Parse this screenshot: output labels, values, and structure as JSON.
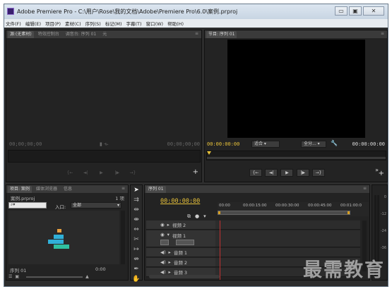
{
  "window": {
    "title": "Adobe Premiere Pro - C:\\用户\\Rose\\我的文档\\Adobe\\Premiere Pro\\6.0\\案例.prproj",
    "min_glyph": "▭",
    "max_glyph": "▣",
    "close_glyph": "✕"
  },
  "menu": [
    "文件(F)",
    "编辑(E)",
    "项目(P)",
    "素材(C)",
    "序列(S)",
    "标记(M)",
    "字幕(T)",
    "窗口(W)",
    "帮助(H)"
  ],
  "source_panel": {
    "tabs": [
      "源:(无素材)",
      "特效控制台",
      "调音台: 序列 01",
      "元"
    ],
    "timecode_left": "00;00;00;00",
    "timecode_right": "00;00;00;00"
  },
  "program_panel": {
    "tabs": [
      "节目: 序列 01"
    ],
    "timecode_left": "00:00:00:00",
    "fit_label": "适合",
    "quality_label": "全分...",
    "timecode_right": "00:00:00:00"
  },
  "project_panel": {
    "tabs": [
      "项目: 案例",
      "媒体浏览器",
      "信息"
    ],
    "project_file": "案例.prproj",
    "item_count": "1 项",
    "search_placeholder": "",
    "entry_label": "入口:",
    "entry_value": "全部",
    "item_name": "序列 01",
    "item_duration": "0:00"
  },
  "timeline_panel": {
    "tabs": [
      "序列 01"
    ],
    "timecode": "00:00:00:00",
    "ruler_labels": [
      "00:00",
      "00:00:15:00",
      "00:00:30:00",
      "00:00:45:00",
      "00:01:00:0"
    ],
    "tracks": [
      {
        "name": "视频 2",
        "type": "video"
      },
      {
        "name": "视频 1",
        "type": "video"
      },
      {
        "name": "音频 1",
        "type": "audio"
      },
      {
        "name": "音频 2",
        "type": "audio"
      },
      {
        "name": "音频 3",
        "type": "audio"
      }
    ]
  },
  "meter_labels": [
    "0",
    "-12",
    "-24",
    "-36"
  ],
  "watermark": "最需教育",
  "colors": {
    "timecode": "#e8c23a",
    "accent_blue": "#2fa0c8",
    "playhead_red": "#c03030",
    "work_area": "#d8a020"
  }
}
